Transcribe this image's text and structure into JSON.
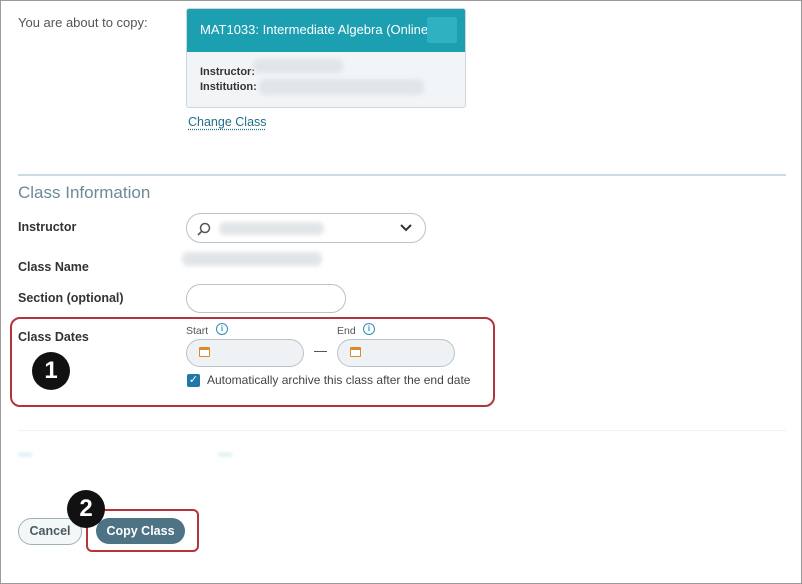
{
  "copy": {
    "label": "You are about to copy:",
    "course_title": "MAT1033: Intermediate Algebra (Online)",
    "instructor_label": "Instructor:",
    "institution_label": "Institution:",
    "change_class_link": "Change Class"
  },
  "class_info": {
    "title": "Class Information",
    "instructor_label": "Instructor",
    "class_name_label": "Class Name",
    "section_label": "Section (optional)",
    "section_value": "",
    "class_dates_label": "Class Dates",
    "start_label": "Start",
    "end_label": "End",
    "start_value": "",
    "end_value": "",
    "dash": "—",
    "archive_checkbox_label": "Automatically archive this class after the end date",
    "archive_checked": true
  },
  "callouts": {
    "one": "1",
    "two": "2"
  },
  "buttons": {
    "cancel": "Cancel",
    "copy_class": "Copy Class"
  },
  "icons": {
    "instructor_search": "search-icon",
    "instructor_dropdown": "chevron-down-icon",
    "info": "info-icon",
    "calendar": "calendar-icon",
    "check": "checkmark-icon"
  },
  "colors": {
    "card_header": "#1d9fb2",
    "highlight": "#b3343a",
    "copy_button": "#4d7384",
    "link": "#1f6f8b"
  }
}
